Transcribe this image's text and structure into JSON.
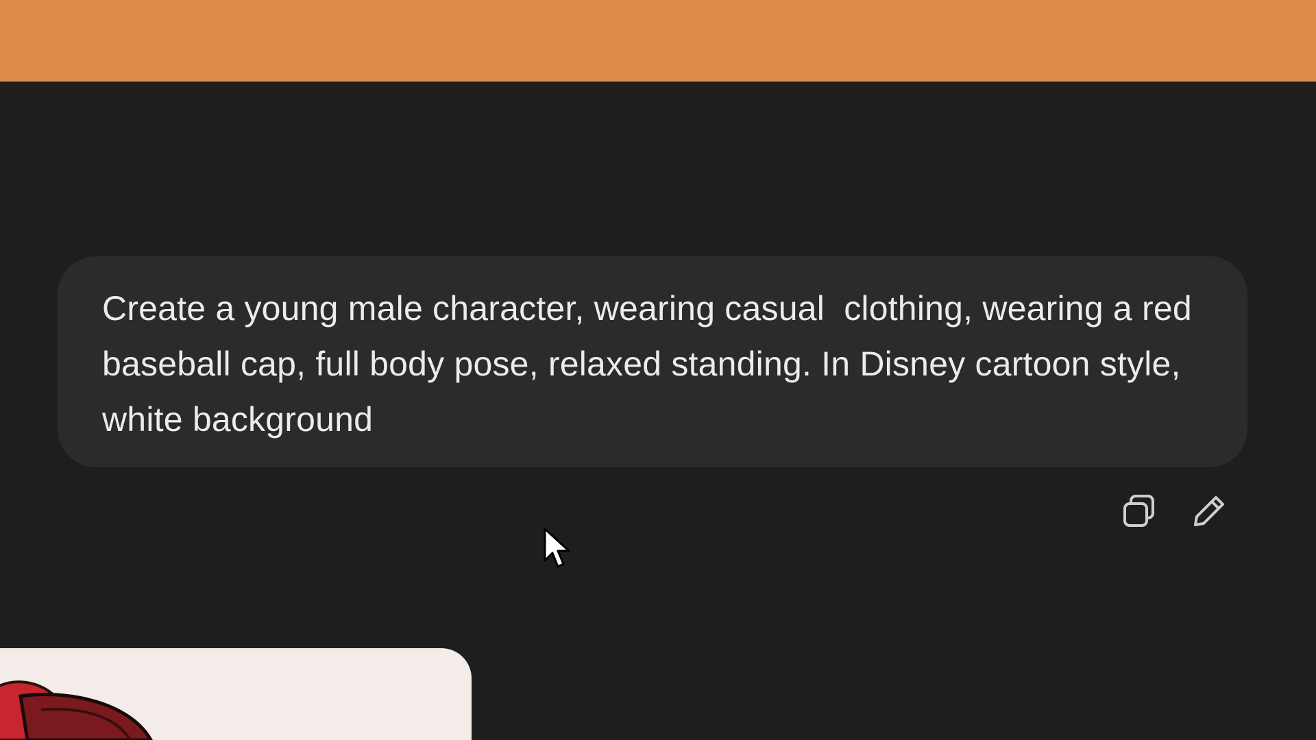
{
  "prompt": {
    "text": "Create a young male character, wearing casual  clothing, wearing a red baseball cap, full body pose, relaxed standing. In Disney cartoon style, white background"
  },
  "actions": {
    "copy_icon": "copy-icon",
    "edit_icon": "pencil-icon"
  },
  "colors": {
    "banner": "#df8b48",
    "background": "#1e1e1f",
    "bubble": "#2b2b2c",
    "text": "#ececec",
    "card": "#f4ece8",
    "cap_red": "#c8262e"
  }
}
